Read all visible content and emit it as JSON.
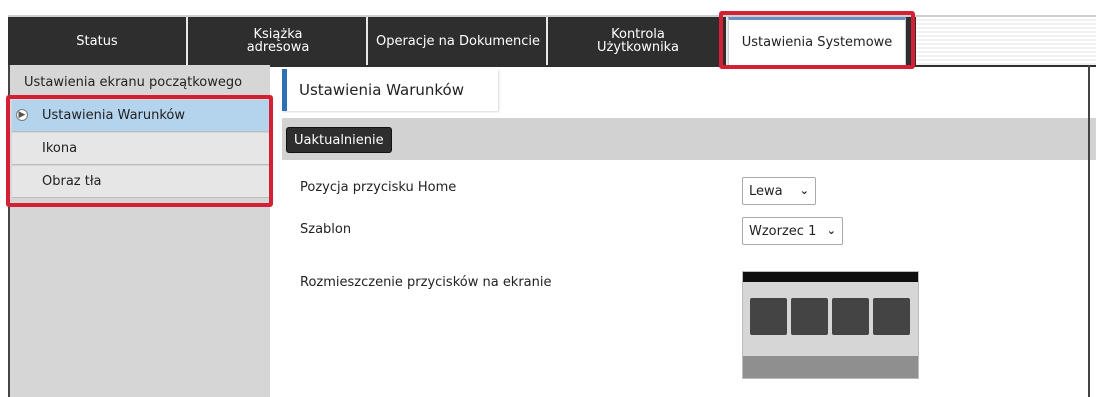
{
  "tabs": [
    {
      "label": "Status",
      "active": false
    },
    {
      "label": "Książka\nadresowa",
      "active": false
    },
    {
      "label": "Operacje na Dokumencie",
      "active": false
    },
    {
      "label": "Kontrola\nUżytkownika",
      "active": false
    },
    {
      "label": "Ustawienia Systemowe",
      "active": true
    }
  ],
  "sidebar": {
    "header": "Ustawienia ekranu początkowego",
    "items": [
      {
        "label": "Ustawienia Warunków",
        "selected": true
      },
      {
        "label": "Ikona",
        "selected": false
      },
      {
        "label": "Obraz tła",
        "selected": false
      }
    ]
  },
  "main": {
    "title": "Ustawienia Warunków",
    "update_button": "Uaktualnienie",
    "home_position_label": "Pozycja przycisku Home",
    "home_position_value": "Lewa",
    "template_label": "Szablon",
    "template_value": "Wzorzec 1",
    "layout_label": "Rozmieszczenie przycisków na ekranie"
  },
  "colors": {
    "highlight": "#d32034",
    "tab_bg": "#2e2e2e",
    "selected_item": "#b4d4ee",
    "title_accent": "#2f6fb4"
  },
  "icons": {
    "select_arrow": "chevron-down-icon",
    "sidebar_selected": "chevron-right-circle-icon"
  }
}
